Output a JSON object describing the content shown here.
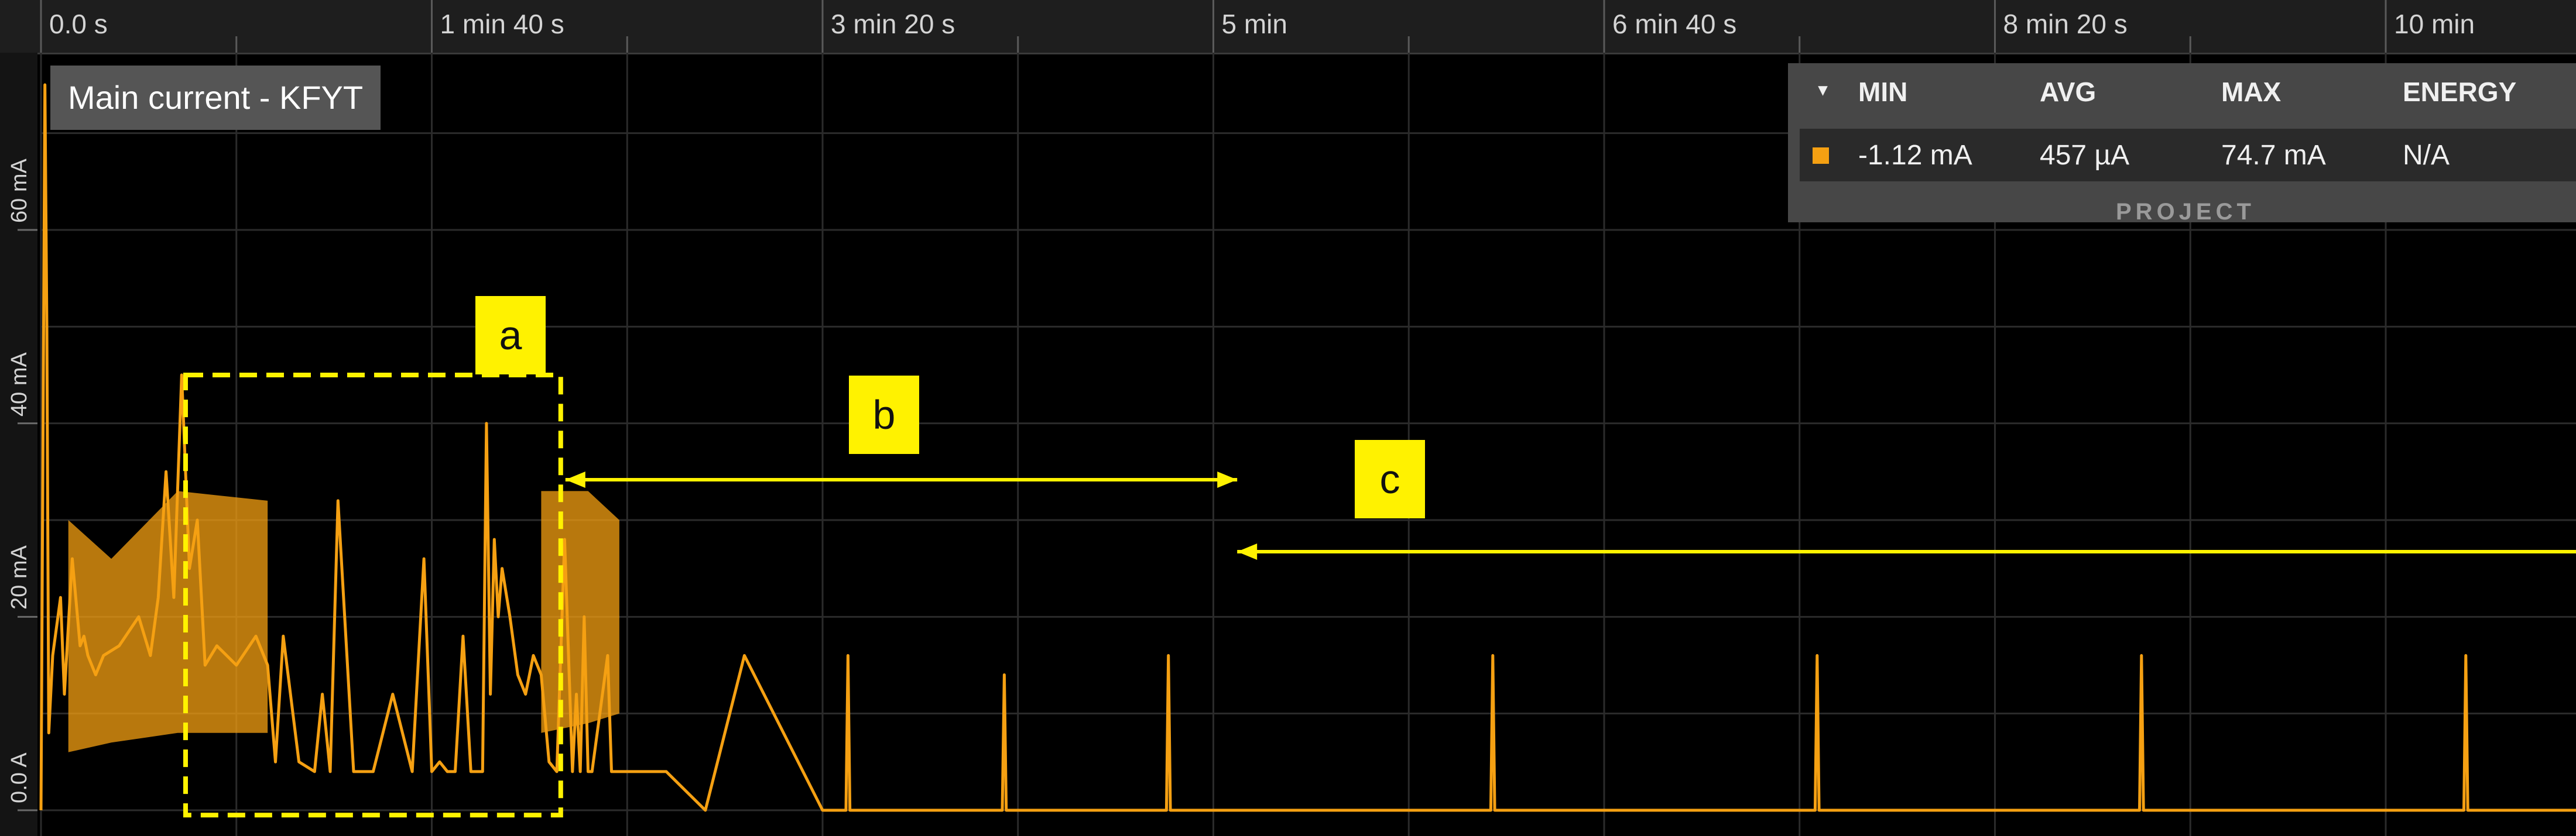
{
  "chart_data": {
    "type": "line",
    "title": "Main current - KFYT",
    "xlabel": "",
    "ylabel": "",
    "x_tick_labels": [
      "0.0 s",
      "1 min 40 s",
      "3 min 20 s",
      "5 min",
      "6 min 40 s",
      "8 min 20 s",
      "10 min"
    ],
    "x_ticks_seconds": [
      0,
      100,
      200,
      300,
      400,
      500,
      600
    ],
    "y_tick_labels": [
      "0.0 A",
      "20 mA",
      "40 mA",
      "60 mA"
    ],
    "y_ticks_mA": [
      0,
      20,
      40,
      60
    ],
    "xlim_seconds": [
      0,
      665
    ],
    "ylim_mA": [
      -1.12,
      75
    ],
    "grid": true,
    "series": [
      {
        "x_seconds": [
          0,
          1,
          1.5,
          2,
          3,
          5,
          6,
          8,
          10,
          11,
          12,
          14,
          16,
          20,
          25,
          28,
          30,
          32,
          34,
          36,
          38,
          40,
          42,
          45,
          50,
          55,
          58,
          60,
          62,
          66,
          70,
          72,
          74,
          76,
          80,
          85,
          90,
          95,
          98,
          100,
          102,
          104,
          106,
          108,
          110,
          111,
          112,
          113,
          114,
          115,
          116,
          117,
          118,
          120,
          122,
          124,
          126,
          128,
          130,
          132,
          134,
          136,
          137,
          138,
          139,
          140,
          141,
          145,
          146,
          147,
          148,
          149,
          150,
          155,
          160,
          170,
          180,
          200,
          206,
          206.5,
          207,
          207.5,
          220,
          246,
          246.5,
          247,
          247.5,
          260,
          288,
          288.5,
          289,
          289.5,
          300,
          371,
          371.5,
          372,
          372.5,
          400,
          454,
          454.5,
          455,
          455.5,
          470,
          537,
          537.5,
          538,
          538.5,
          560,
          620,
          620.5,
          621,
          621.5,
          640,
          655,
          665
        ],
        "y_mA": [
          0,
          75,
          50,
          8,
          16,
          22,
          12,
          26,
          17,
          18,
          16,
          14,
          16,
          17,
          20,
          16,
          22,
          35,
          22,
          45,
          25,
          30,
          15,
          17,
          15,
          18,
          15,
          5,
          18,
          5,
          4,
          12,
          4,
          32,
          4,
          4,
          12,
          4,
          26,
          4,
          5,
          4,
          4,
          18,
          4,
          4,
          4,
          4,
          40,
          12,
          28,
          20,
          25,
          20,
          14,
          12,
          16,
          14,
          5,
          4,
          28,
          4,
          12,
          4,
          20,
          4,
          4,
          16,
          4,
          4,
          4,
          4,
          4,
          4,
          4,
          0,
          16,
          0,
          0,
          16,
          0,
          0,
          0,
          0,
          14,
          0,
          0,
          0,
          0,
          16,
          0,
          0,
          0,
          0,
          16,
          0,
          0,
          0,
          0,
          16,
          0,
          0,
          0,
          0,
          16,
          0,
          0,
          0,
          0,
          16,
          0,
          0,
          0,
          0,
          0
        ]
      }
    ],
    "summary": {
      "headers": [
        "MIN",
        "AVG",
        "MAX",
        "ENERGY"
      ],
      "values": [
        "-1.12 mA",
        "457 µA",
        "74.7 mA",
        "N/A"
      ],
      "footer": "PROJECT"
    },
    "annotations": [
      {
        "label": "a",
        "x_range_seconds": [
          37,
          133
        ],
        "y_range_mA": [
          -0.5,
          45
        ]
      },
      {
        "label": "b",
        "x_range_seconds": [
          133,
          304
        ]
      },
      {
        "label": "c",
        "x_range_seconds": [
          304,
          655
        ]
      }
    ],
    "colors": {
      "series": "#f5a012",
      "annotation": "#fff200",
      "grid": "#2b2b2b"
    }
  }
}
